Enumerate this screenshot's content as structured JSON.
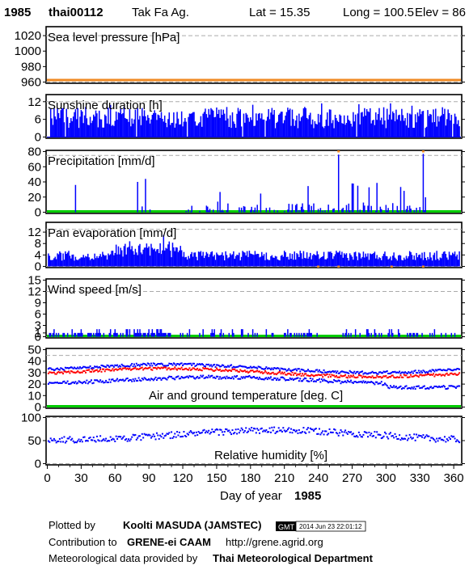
{
  "header": {
    "year": "1985",
    "station_id": "thai00112",
    "station_name": "Tak Fa Ag.",
    "lat": "Lat = 15.35",
    "long": "Long = 100.5",
    "elev": "Elev = 86"
  },
  "chart_data": [
    {
      "type": "line",
      "title": "Sea level pressure [hPa]",
      "ylim": [
        960,
        1030
      ],
      "yticks": [
        960,
        980,
        1000,
        1020
      ],
      "ref_lines": [
        960,
        1020
      ],
      "series": [
        {
          "values_desc": "missing data marker along bottom",
          "missing": true
        }
      ]
    },
    {
      "type": "bar",
      "title": "Sunshine duration [h]",
      "ylim": [
        0,
        14
      ],
      "yticks": [
        0,
        6,
        12
      ],
      "ref_lines": [
        0,
        12
      ],
      "series": [
        {
          "typical_range": [
            3,
            10
          ],
          "color": "#0000ff"
        }
      ]
    },
    {
      "type": "bar",
      "title": "Precipitation [mm/d]",
      "ylim": [
        0,
        80
      ],
      "yticks": [
        0,
        20,
        40,
        60,
        80
      ],
      "ref_lines": [
        0,
        75
      ],
      "peaks": [
        {
          "day": 25,
          "value": 36
        },
        {
          "day": 80,
          "value": 40
        },
        {
          "day": 87,
          "value": 44
        },
        {
          "day": 258,
          "value": 76
        },
        {
          "day": 333,
          "value": 77
        }
      ],
      "series": [
        {
          "color": "#0000ff"
        }
      ]
    },
    {
      "type": "bar",
      "title": "Pan evaporation [mm/d]",
      "ylim": [
        0,
        15
      ],
      "yticks": [
        0,
        4,
        8,
        12
      ],
      "ref_lines": [
        0,
        13
      ],
      "series": [
        {
          "typical_range": [
            2,
            6
          ],
          "peak": 11,
          "color": "#0000ff"
        }
      ]
    },
    {
      "type": "bar",
      "title": "Wind speed [m/s]",
      "ylim": [
        0,
        15
      ],
      "yticks": [
        0,
        1,
        3,
        6,
        9,
        12,
        15
      ],
      "ref_lines": [
        0,
        12
      ],
      "series": [
        {
          "typical": 1,
          "color": "#0000ff"
        }
      ]
    },
    {
      "type": "scatter",
      "title": "Air and ground temperature [deg. C]",
      "ylim": [
        0,
        50
      ],
      "yticks": [
        0,
        10,
        20,
        30,
        40,
        50
      ],
      "ref_lines": [
        0,
        45
      ],
      "series": [
        {
          "color": "#0000ff",
          "approx": "max temp ~32-38"
        },
        {
          "color": "#ff0000",
          "approx": "mean ~29-35"
        },
        {
          "color": "#0000ff",
          "approx": "min temp ~17-27"
        }
      ]
    },
    {
      "type": "scatter",
      "title": "Relative humidity [%]",
      "ylim": [
        0,
        100
      ],
      "yticks": [
        0,
        50,
        100
      ],
      "ref_lines": [
        0,
        100
      ],
      "series": [
        {
          "color": "#0000ff",
          "approx": "range 50-85"
        }
      ]
    }
  ],
  "xaxis": {
    "label": "Day of year",
    "year": "1985",
    "ticks": [
      0,
      30,
      60,
      90,
      120,
      150,
      180,
      210,
      240,
      270,
      300,
      330,
      360
    ],
    "range": [
      0,
      366
    ]
  },
  "footer": {
    "plotted_by_label": "Plotted by",
    "plotted_by": "Koolti MASUDA (JAMSTEC)",
    "gmt_logo": "GMT",
    "timestamp": "2014 Jun 23 22:01:12",
    "contribution_label": "Contribution to",
    "contribution": "GRENE-ei CAAM",
    "url": "http://grene.agrid.org",
    "provider_label": "Meteorological data provided by",
    "provider": "Thai Meteorological Department"
  },
  "colors": {
    "bars": "#0000ff",
    "red": "#ff0000",
    "green": "#00cc00",
    "orange": "#f08a24",
    "dashed": "#aaaaaa"
  }
}
